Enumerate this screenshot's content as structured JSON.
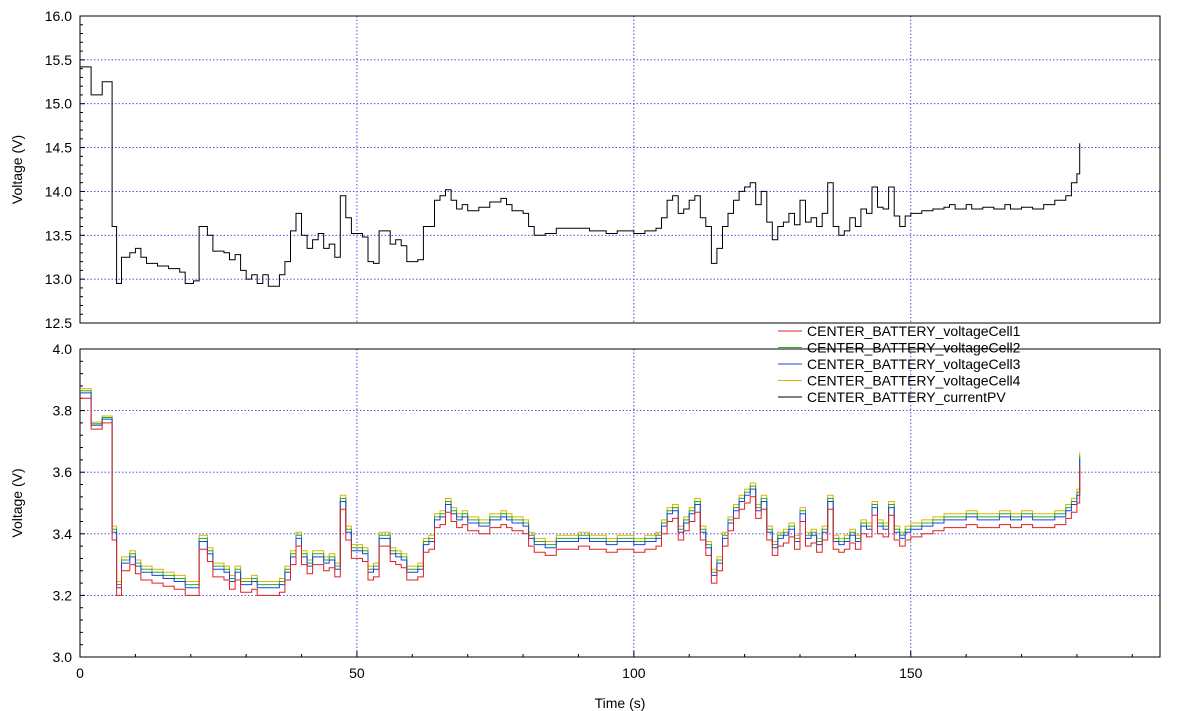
{
  "chart_data": [
    {
      "type": "line",
      "ylabel": "Voltage (V)",
      "ylim": [
        12.5,
        16.0
      ],
      "yticks": [
        "12.5",
        "13.0",
        "13.5",
        "14.0",
        "14.5",
        "15.0",
        "15.5",
        "16.0"
      ],
      "xlim": [
        0,
        195
      ],
      "grid": true,
      "series": [
        {
          "name": "CENTER_BATTERY_currentPV",
          "color": "#000000",
          "points": [
            [
              0,
              15.42
            ],
            [
              2,
              15.1
            ],
            [
              4,
              15.25
            ],
            [
              5.5,
              15.25
            ],
            [
              5.8,
              13.6
            ],
            [
              6.6,
              12.95
            ],
            [
              7.5,
              13.25
            ],
            [
              9,
              13.3
            ],
            [
              10,
              13.35
            ],
            [
              11,
              13.25
            ],
            [
              12,
              13.18
            ],
            [
              14,
              13.15
            ],
            [
              16,
              13.12
            ],
            [
              18,
              13.08
            ],
            [
              19,
              12.95
            ],
            [
              20.5,
              12.98
            ],
            [
              21.5,
              13.6
            ],
            [
              23,
              13.5
            ],
            [
              24,
              13.32
            ],
            [
              26,
              13.3
            ],
            [
              27,
              13.22
            ],
            [
              28,
              13.28
            ],
            [
              29,
              13.1
            ],
            [
              30,
              13.0
            ],
            [
              31,
              13.05
            ],
            [
              32,
              12.95
            ],
            [
              33,
              13.05
            ],
            [
              34,
              12.92
            ],
            [
              36,
              13.05
            ],
            [
              37,
              13.2
            ],
            [
              38,
              13.55
            ],
            [
              39,
              13.75
            ],
            [
              40,
              13.5
            ],
            [
              41,
              13.35
            ],
            [
              42,
              13.45
            ],
            [
              43,
              13.52
            ],
            [
              44,
              13.35
            ],
            [
              45,
              13.4
            ],
            [
              46,
              13.25
            ],
            [
              47,
              13.95
            ],
            [
              48,
              13.7
            ],
            [
              49,
              13.52
            ],
            [
              51,
              13.48
            ],
            [
              52,
              13.2
            ],
            [
              53,
              13.18
            ],
            [
              54,
              13.55
            ],
            [
              56,
              13.4
            ],
            [
              57,
              13.45
            ],
            [
              58,
              13.38
            ],
            [
              59,
              13.2
            ],
            [
              61,
              13.22
            ],
            [
              62,
              13.6
            ],
            [
              63,
              13.6
            ],
            [
              64,
              13.9
            ],
            [
              65,
              13.95
            ],
            [
              66,
              14.02
            ],
            [
              67,
              13.9
            ],
            [
              68,
              13.8
            ],
            [
              69,
              13.85
            ],
            [
              70,
              13.78
            ],
            [
              72,
              13.82
            ],
            [
              74,
              13.88
            ],
            [
              76,
              13.92
            ],
            [
              77,
              13.85
            ],
            [
              78,
              13.78
            ],
            [
              80,
              13.75
            ],
            [
              81,
              13.6
            ],
            [
              82,
              13.5
            ],
            [
              84,
              13.52
            ],
            [
              86,
              13.58
            ],
            [
              90,
              13.58
            ],
            [
              92,
              13.55
            ],
            [
              95,
              13.52
            ],
            [
              97,
              13.55
            ],
            [
              100,
              13.52
            ],
            [
              102,
              13.55
            ],
            [
              104,
              13.58
            ],
            [
              105,
              13.7
            ],
            [
              106,
              13.9
            ],
            [
              107,
              13.95
            ],
            [
              108,
              13.75
            ],
            [
              109,
              13.8
            ],
            [
              110,
              13.9
            ],
            [
              111,
              13.95
            ],
            [
              112,
              13.7
            ],
            [
              113,
              13.6
            ],
            [
              114,
              13.18
            ],
            [
              115,
              13.35
            ],
            [
              116,
              13.6
            ],
            [
              117,
              13.75
            ],
            [
              118,
              13.9
            ],
            [
              119,
              14.0
            ],
            [
              120,
              14.05
            ],
            [
              121,
              14.1
            ],
            [
              122,
              13.85
            ],
            [
              123,
              14.0
            ],
            [
              124,
              13.65
            ],
            [
              125,
              13.45
            ],
            [
              126,
              13.6
            ],
            [
              127,
              13.65
            ],
            [
              128,
              13.75
            ],
            [
              129,
              13.62
            ],
            [
              130,
              13.9
            ],
            [
              131,
              13.65
            ],
            [
              132,
              13.7
            ],
            [
              133,
              13.6
            ],
            [
              134,
              13.75
            ],
            [
              135,
              14.1
            ],
            [
              136,
              13.6
            ],
            [
              137,
              13.5
            ],
            [
              138,
              13.55
            ],
            [
              139,
              13.7
            ],
            [
              140,
              13.6
            ],
            [
              141,
              13.8
            ],
            [
              142,
              13.75
            ],
            [
              143,
              14.05
            ],
            [
              144,
              13.82
            ],
            [
              145,
              13.8
            ],
            [
              146,
              14.05
            ],
            [
              147,
              13.72
            ],
            [
              148,
              13.6
            ],
            [
              149,
              13.72
            ],
            [
              150,
              13.75
            ],
            [
              152,
              13.78
            ],
            [
              154,
              13.8
            ],
            [
              156,
              13.82
            ],
            [
              157,
              13.85
            ],
            [
              158,
              13.8
            ],
            [
              160,
              13.85
            ],
            [
              161,
              13.8
            ],
            [
              163,
              13.82
            ],
            [
              165,
              13.8
            ],
            [
              167,
              13.85
            ],
            [
              168,
              13.8
            ],
            [
              170,
              13.82
            ],
            [
              172,
              13.8
            ],
            [
              174,
              13.85
            ],
            [
              176,
              13.9
            ],
            [
              178,
              13.95
            ],
            [
              179,
              14.1
            ],
            [
              180,
              14.2
            ],
            [
              180.5,
              14.55
            ]
          ]
        }
      ]
    },
    {
      "type": "line",
      "xlabel": "Time (s)",
      "ylabel": "Voltage (V)",
      "ylim": [
        3.0,
        4.0
      ],
      "yticks": [
        "3.0",
        "3.2",
        "3.4",
        "3.6",
        "3.8",
        "4.0"
      ],
      "xlim": [
        0,
        195
      ],
      "xticks": [
        "0",
        "50",
        "100",
        "150"
      ],
      "grid": true,
      "legend": "top-right",
      "series": [
        {
          "name": "CENTER_BATTERY_voltageCell1",
          "color": "#e02020",
          "offset": 0.0
        },
        {
          "name": "CENTER_BATTERY_voltageCell2",
          "color": "#20b020",
          "offset": 0.035
        },
        {
          "name": "CENTER_BATTERY_voltageCell3",
          "color": "#2040e0",
          "offset": 0.025
        },
        {
          "name": "CENTER_BATTERY_voltageCell4",
          "color": "#e0b000",
          "offset": 0.045
        },
        {
          "name": "CENTER_BATTERY_currentPV",
          "color": "#000000",
          "legend_only": true
        }
      ],
      "base_points": [
        [
          0,
          3.84
        ],
        [
          2,
          3.74
        ],
        [
          4,
          3.76
        ],
        [
          5.5,
          3.76
        ],
        [
          5.8,
          3.38
        ],
        [
          6.6,
          3.2
        ],
        [
          7.5,
          3.28
        ],
        [
          9,
          3.3
        ],
        [
          10,
          3.27
        ],
        [
          11,
          3.25
        ],
        [
          13,
          3.24
        ],
        [
          15,
          3.23
        ],
        [
          17,
          3.22
        ],
        [
          19,
          3.2
        ],
        [
          20.5,
          3.2
        ],
        [
          21.5,
          3.35
        ],
        [
          23,
          3.31
        ],
        [
          24,
          3.26
        ],
        [
          26,
          3.25
        ],
        [
          27,
          3.22
        ],
        [
          28,
          3.25
        ],
        [
          29,
          3.21
        ],
        [
          30,
          3.21
        ],
        [
          31,
          3.22
        ],
        [
          32,
          3.2
        ],
        [
          34,
          3.2
        ],
        [
          36,
          3.21
        ],
        [
          37,
          3.25
        ],
        [
          38,
          3.3
        ],
        [
          39,
          3.36
        ],
        [
          40,
          3.3
        ],
        [
          41,
          3.27
        ],
        [
          42,
          3.3
        ],
        [
          43,
          3.3
        ],
        [
          44,
          3.28
        ],
        [
          45,
          3.29
        ],
        [
          46,
          3.26
        ],
        [
          47,
          3.48
        ],
        [
          48,
          3.38
        ],
        [
          49,
          3.32
        ],
        [
          51,
          3.31
        ],
        [
          52,
          3.25
        ],
        [
          53,
          3.26
        ],
        [
          54,
          3.36
        ],
        [
          56,
          3.31
        ],
        [
          57,
          3.3
        ],
        [
          58,
          3.29
        ],
        [
          59,
          3.25
        ],
        [
          61,
          3.26
        ],
        [
          62,
          3.34
        ],
        [
          63,
          3.35
        ],
        [
          64,
          3.42
        ],
        [
          65,
          3.43
        ],
        [
          66,
          3.47
        ],
        [
          67,
          3.44
        ],
        [
          68,
          3.42
        ],
        [
          69,
          3.43
        ],
        [
          70,
          3.41
        ],
        [
          72,
          3.4
        ],
        [
          74,
          3.42
        ],
        [
          76,
          3.43
        ],
        [
          77,
          3.42
        ],
        [
          78,
          3.41
        ],
        [
          80,
          3.4
        ],
        [
          81,
          3.36
        ],
        [
          82,
          3.34
        ],
        [
          84,
          3.33
        ],
        [
          86,
          3.35
        ],
        [
          90,
          3.36
        ],
        [
          92,
          3.35
        ],
        [
          95,
          3.34
        ],
        [
          97,
          3.35
        ],
        [
          100,
          3.34
        ],
        [
          102,
          3.35
        ],
        [
          104,
          3.36
        ],
        [
          105,
          3.4
        ],
        [
          106,
          3.44
        ],
        [
          107,
          3.45
        ],
        [
          108,
          3.38
        ],
        [
          109,
          3.41
        ],
        [
          110,
          3.44
        ],
        [
          111,
          3.47
        ],
        [
          112,
          3.38
        ],
        [
          113,
          3.33
        ],
        [
          114,
          3.24
        ],
        [
          115,
          3.28
        ],
        [
          116,
          3.36
        ],
        [
          117,
          3.41
        ],
        [
          118,
          3.45
        ],
        [
          119,
          3.48
        ],
        [
          120,
          3.5
        ],
        [
          121,
          3.52
        ],
        [
          122,
          3.45
        ],
        [
          123,
          3.48
        ],
        [
          124,
          3.38
        ],
        [
          125,
          3.33
        ],
        [
          126,
          3.36
        ],
        [
          127,
          3.37
        ],
        [
          128,
          3.39
        ],
        [
          129,
          3.35
        ],
        [
          130,
          3.44
        ],
        [
          131,
          3.36
        ],
        [
          132,
          3.37
        ],
        [
          133,
          3.34
        ],
        [
          134,
          3.38
        ],
        [
          135,
          3.48
        ],
        [
          136,
          3.35
        ],
        [
          137,
          3.34
        ],
        [
          138,
          3.35
        ],
        [
          139,
          3.37
        ],
        [
          140,
          3.35
        ],
        [
          141,
          3.4
        ],
        [
          142,
          3.39
        ],
        [
          143,
          3.46
        ],
        [
          144,
          3.4
        ],
        [
          145,
          3.39
        ],
        [
          146,
          3.46
        ],
        [
          147,
          3.38
        ],
        [
          148,
          3.36
        ],
        [
          149,
          3.38
        ],
        [
          150,
          3.39
        ],
        [
          152,
          3.4
        ],
        [
          154,
          3.41
        ],
        [
          156,
          3.42
        ],
        [
          158,
          3.42
        ],
        [
          160,
          3.43
        ],
        [
          162,
          3.42
        ],
        [
          164,
          3.42
        ],
        [
          166,
          3.43
        ],
        [
          168,
          3.42
        ],
        [
          170,
          3.43
        ],
        [
          172,
          3.42
        ],
        [
          174,
          3.42
        ],
        [
          176,
          3.43
        ],
        [
          178,
          3.45
        ],
        [
          179,
          3.47
        ],
        [
          180,
          3.5
        ],
        [
          180.5,
          3.62
        ]
      ]
    }
  ]
}
